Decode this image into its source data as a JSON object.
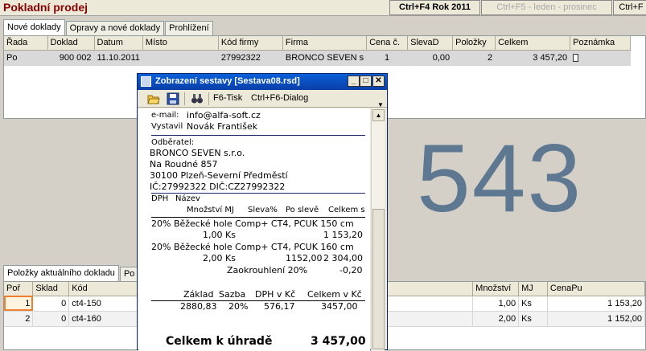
{
  "app": {
    "title": "Pokladní prodej",
    "year_button": "Ctrl+F4 Rok 2011",
    "period_button": "Ctrl+F5 - leden - prosinec",
    "next_button": "Ctrl+F"
  },
  "top_tabs": [
    "Nové doklady",
    "Opravy a nové doklady",
    "Prohlížení"
  ],
  "doc_grid": {
    "headers": [
      "Řada",
      "Doklad",
      "Datum",
      "Místo",
      "Kód firmy",
      "Firma",
      "Cena č.",
      "SlevaD",
      "Položky",
      "Celkem",
      "Poznámka"
    ],
    "row": {
      "rada": "Po",
      "doklad": "900 002",
      "datum": "11.10.2011",
      "misto": "",
      "kod_firmy": "27992322",
      "firma": "BRONCO SEVEN s",
      "cena": "1",
      "sleva": "0,00",
      "polozky": "2",
      "celkem": "3 457,20"
    }
  },
  "big_number": "543",
  "bottom_tabs": [
    "Položky aktuálního dokladu",
    "Po"
  ],
  "items_grid": {
    "headers": [
      "Poř",
      "Sklad",
      "Kód",
      "Množství",
      "MJ",
      "CenaPu"
    ],
    "rows": [
      {
        "por": "1",
        "sklad": "0",
        "kod": "ct4-150",
        "mnozstvi": "1,00",
        "mj": "Ks",
        "cena": "1 153,20"
      },
      {
        "por": "2",
        "sklad": "0",
        "kod": "ct4-160",
        "mnozstvi": "2,00",
        "mj": "Ks",
        "cena": "1 152,00"
      }
    ]
  },
  "report_window": {
    "title": "Zobrazení sestavy [Sestava08.rsd]",
    "print_button": "F6-Tisk",
    "dialog_button": "Ctrl+F6-Dialog",
    "email_label": "e-mail:",
    "email_value": "info@alfa-soft.cz",
    "issued_label": "Vystavil",
    "issued_value": "Novák František",
    "customer_label": "Odběratel:",
    "customer_name": "BRONCO SEVEN s.r.o.",
    "customer_street": "Na Roudné 857",
    "customer_city": "30100 Plzeň-Severní Předměstí",
    "customer_ids": "IČ:27992322    DIČ:CZ27992322",
    "col_dph": "DPH",
    "col_name": "Název",
    "col_qty": "Množství MJ",
    "col_disc": "Sleva%",
    "col_after": "Po slevě",
    "col_total": "Celkem s",
    "item1_desc": "20%  Běžecké hole Comp+ CT4, PCUK 150 cm",
    "item1_qty": "1,00 Ks",
    "item1_total": "1 153,20",
    "item2_desc": "20%  Běžecké hole Comp+ CT4, PCUK 160 cm",
    "item2_qty": "2,00 Ks",
    "item2_after": "1152,00",
    "item2_total": "2 304,00",
    "rounding_label": "Zaokrouhlení 20%",
    "rounding_value": "-0,20",
    "sum_base_label": "Základ",
    "sum_rate_label": "Sazba",
    "sum_vat_label": "DPH v Kč",
    "sum_total_label": "Celkem v Kč",
    "sum_base": "2880,83",
    "sum_rate": "20%",
    "sum_vat": "576,17",
    "sum_total": "3457,00",
    "due_label": "Celkem k úhradě",
    "due_value": "3 457,00"
  }
}
